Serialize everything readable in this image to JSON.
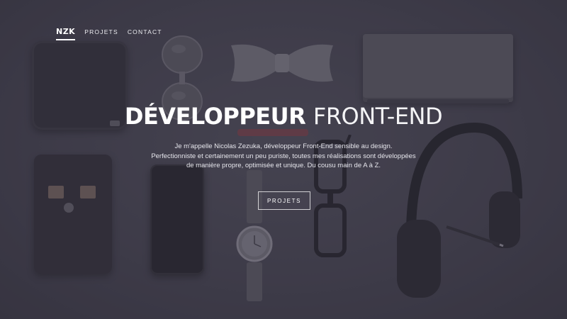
{
  "nav": {
    "logo": "NZK",
    "links": [
      {
        "label": "PROJETS"
      },
      {
        "label": "CONTACT"
      }
    ]
  },
  "hero": {
    "title_bold": "DÉVELOPPEUR",
    "title_light": "FRONT-END",
    "intro_line1": "Je m'appelle Nicolas Zezuka, développeur Front-End sensible au design.",
    "intro_line2": "Perfectionniste et certainement un peu puriste, toutes mes réalisations sont développées",
    "intro_line3": "de manière propre, optimisée et unique. Du cousu main de A à Z.",
    "cta_label": "PROJETS"
  },
  "colors": {
    "background": "#3e3c48",
    "text": "#ffffff",
    "overlay": "#3c3848"
  }
}
